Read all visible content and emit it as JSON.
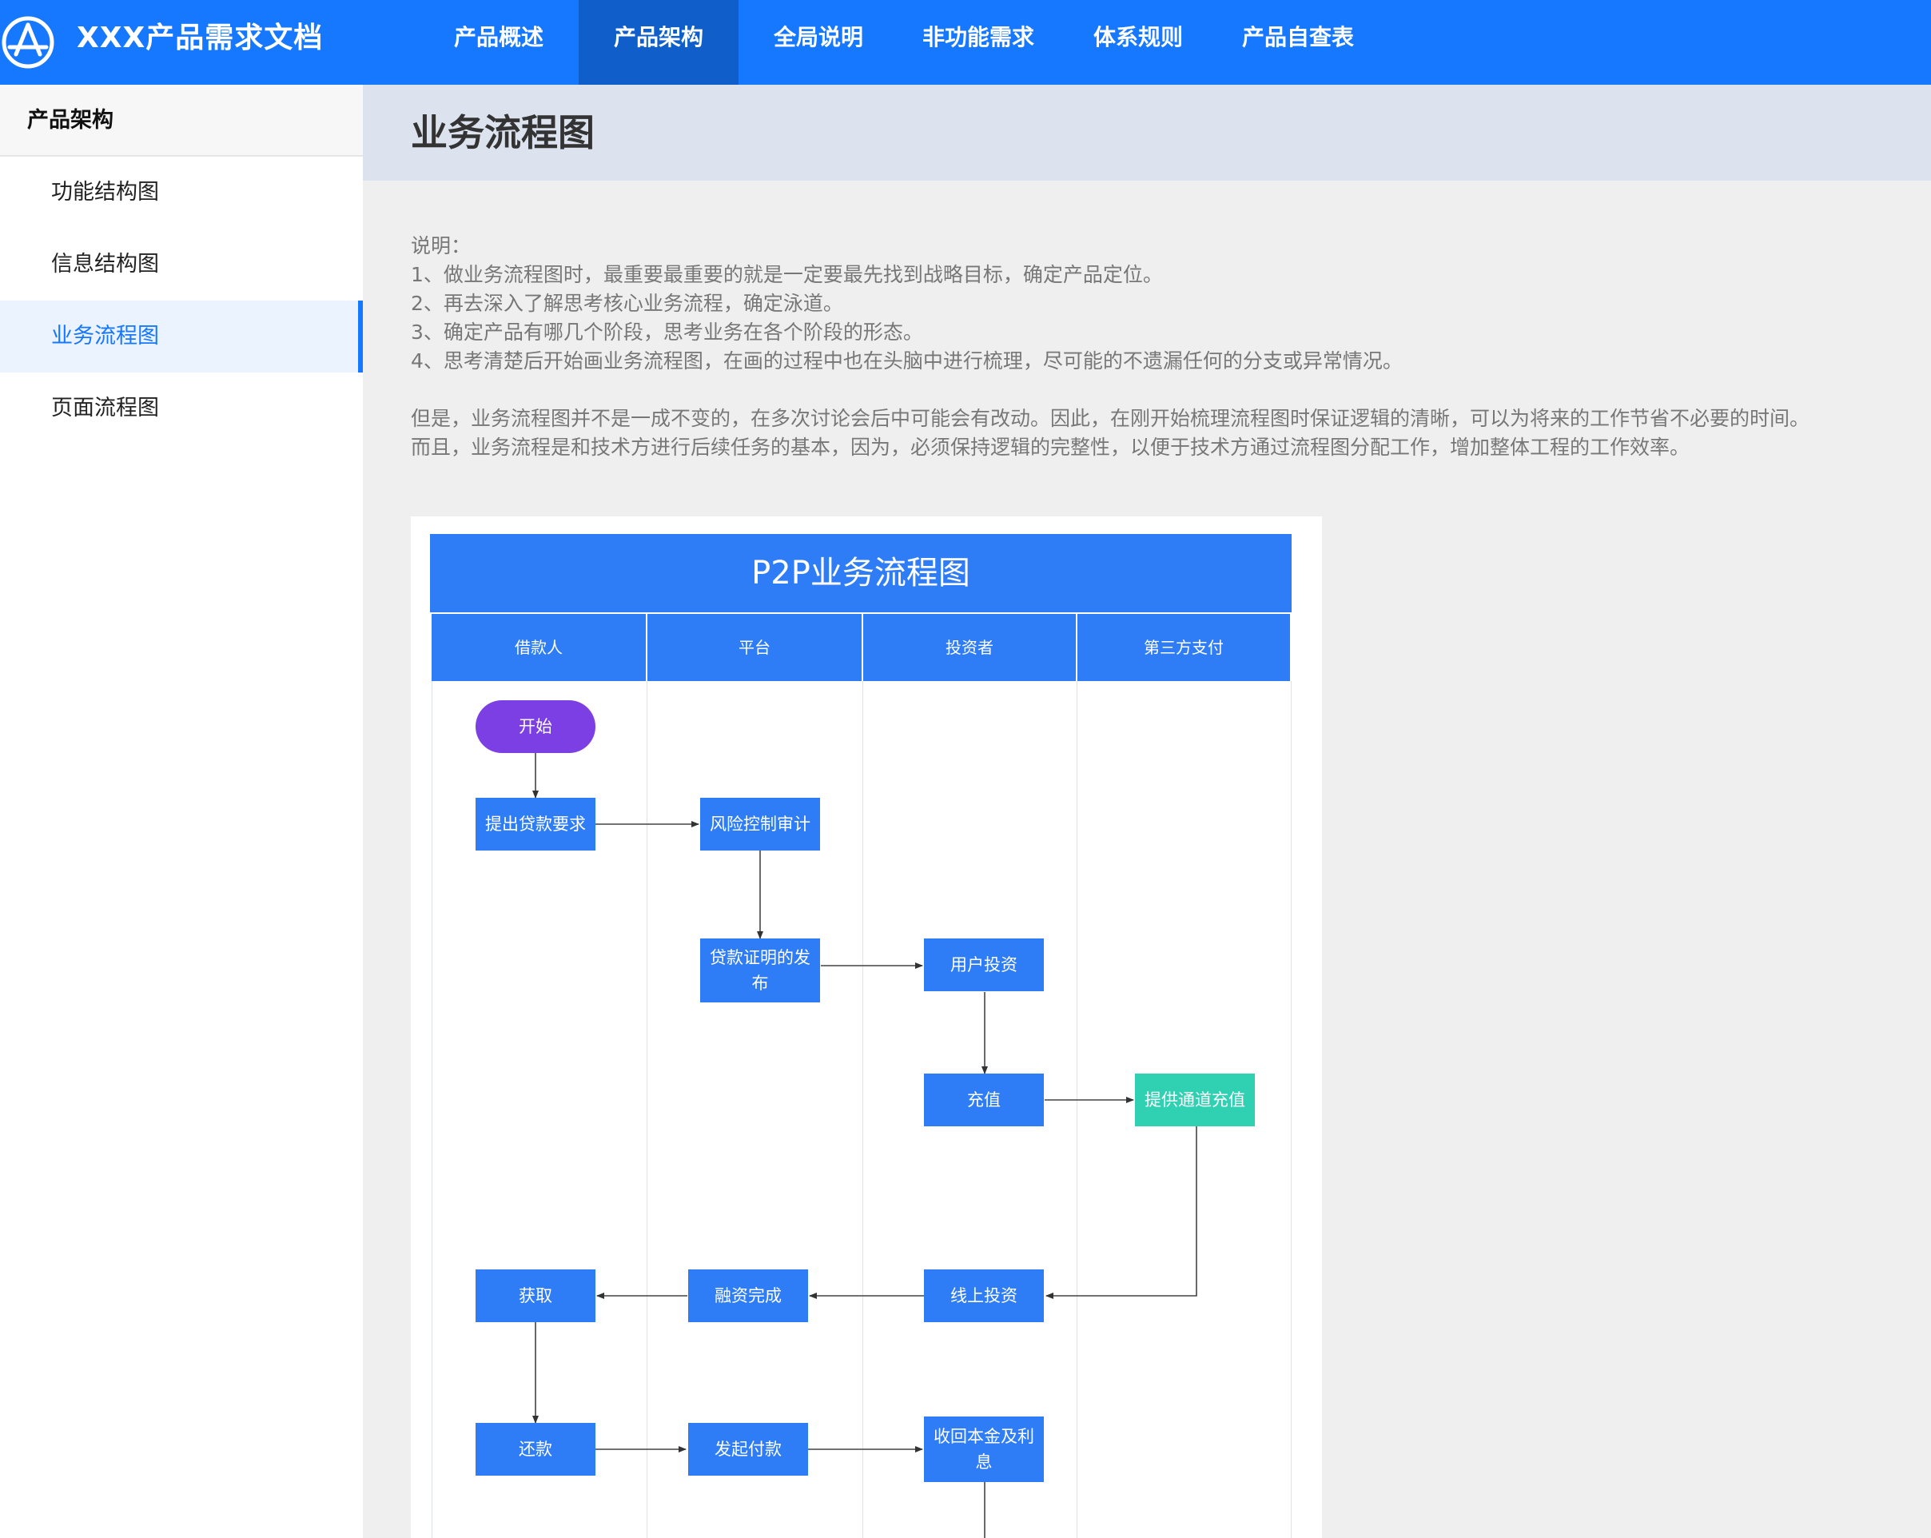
{
  "header": {
    "app_title": "XXX产品需求文档",
    "nav": [
      "产品概述",
      "产品架构",
      "全局说明",
      "非功能需求",
      "体系规则",
      "产品自查表"
    ],
    "active_nav": 1
  },
  "sidebar": {
    "section_title": "产品架构",
    "items": [
      "功能结构图",
      "信息结构图",
      "业务流程图",
      "页面流程图"
    ],
    "active_item": 2
  },
  "main": {
    "page_title": "业务流程图",
    "desc_lines": [
      "说明：",
      "1、做业务流程图时，最重要最重要的就是一定要最先找到战略目标，确定产品定位。",
      "2、再去深入了解思考核心业务流程，确定泳道。",
      "3、确定产品有哪几个阶段，思考业务在各个阶段的形态。",
      "4、思考清楚后开始画业务流程图，在画的过程中也在头脑中进行梳理，尽可能的不遗漏任何的分支或异常情况。"
    ],
    "desc_paragraph": [
      "但是，业务流程图并不是一成不变的，在多次讨论会后中可能会有改动。因此，在刚开始梳理流程图时保证逻辑的清晰，可以为将来的工作节省不必要的时间。",
      "而且，业务流程是和技术方进行后续任务的基本，因为，必须保持逻辑的完整性，以便于技术方通过流程图分配工作，增加整体工程的工作效率。"
    ]
  },
  "diagram": {
    "title": "P2P业务流程图",
    "lanes": [
      "借款人",
      "平台",
      "投资者",
      "第三方支付"
    ],
    "nodes": {
      "start": "开始",
      "loan_request": "提出贷款要求",
      "risk_audit": "风险控制审计",
      "loan_publish": "贷款证明的发布",
      "user_invest": "用户投资",
      "recharge": "充值",
      "channel_recharge": "提供通道充值",
      "online_invest": "线上投资",
      "financing_done": "融资完成",
      "obtain": "获取",
      "repay": "还款",
      "initiate_payment": "发起付款",
      "recover": "收回本金及利息"
    },
    "colors": {
      "primary": "#2f7df6",
      "start": "#7b3fe4",
      "third_party": "#2fd1b2",
      "topbar": "#1677ff"
    }
  }
}
